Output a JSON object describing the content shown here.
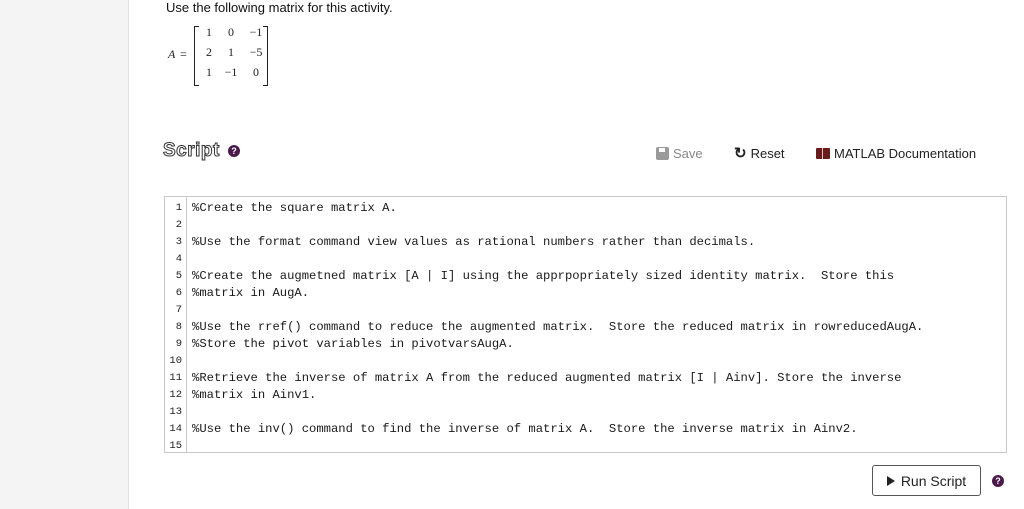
{
  "instruction": "Use the following matrix for this activity.",
  "matrix": {
    "name": "A",
    "equals": "=",
    "rows": [
      [
        "1",
        "0",
        "−1"
      ],
      [
        "2",
        "1",
        "−5"
      ],
      [
        "1",
        "−1",
        "0"
      ]
    ]
  },
  "script": {
    "title": "Script",
    "help_icon": "?"
  },
  "toolbar": {
    "save_label": "Save",
    "reset_label": "Reset",
    "doc_label": "MATLAB Documentation"
  },
  "code_lines": [
    {
      "n": "1",
      "text": "%Create the square matrix A."
    },
    {
      "n": "2",
      "text": ""
    },
    {
      "n": "3",
      "text": "%Use the format command view values as rational numbers rather than decimals."
    },
    {
      "n": "4",
      "text": ""
    },
    {
      "n": "5",
      "text": "%Create the augmetned matrix [A | I] using the apprpopriately sized identity matrix.  Store this"
    },
    {
      "n": "6",
      "text": "%matrix in AugA."
    },
    {
      "n": "7",
      "text": ""
    },
    {
      "n": "8",
      "text": "%Use the rref() command to reduce the augmented matrix.  Store the reduced matrix in rowreducedAugA."
    },
    {
      "n": "9",
      "text": "%Store the pivot variables in pivotvarsAugA."
    },
    {
      "n": "10",
      "text": ""
    },
    {
      "n": "11",
      "text": "%Retrieve the inverse of matrix A from the reduced augmented matrix [I | Ainv]. Store the inverse"
    },
    {
      "n": "12",
      "text": "%matrix in Ainv1."
    },
    {
      "n": "13",
      "text": ""
    },
    {
      "n": "14",
      "text": "%Use the inv() command to find the inverse of matrix A.  Store the inverse matrix in Ainv2."
    },
    {
      "n": "15",
      "text": ""
    }
  ],
  "run": {
    "label": "Run Script",
    "help_icon": "?"
  }
}
